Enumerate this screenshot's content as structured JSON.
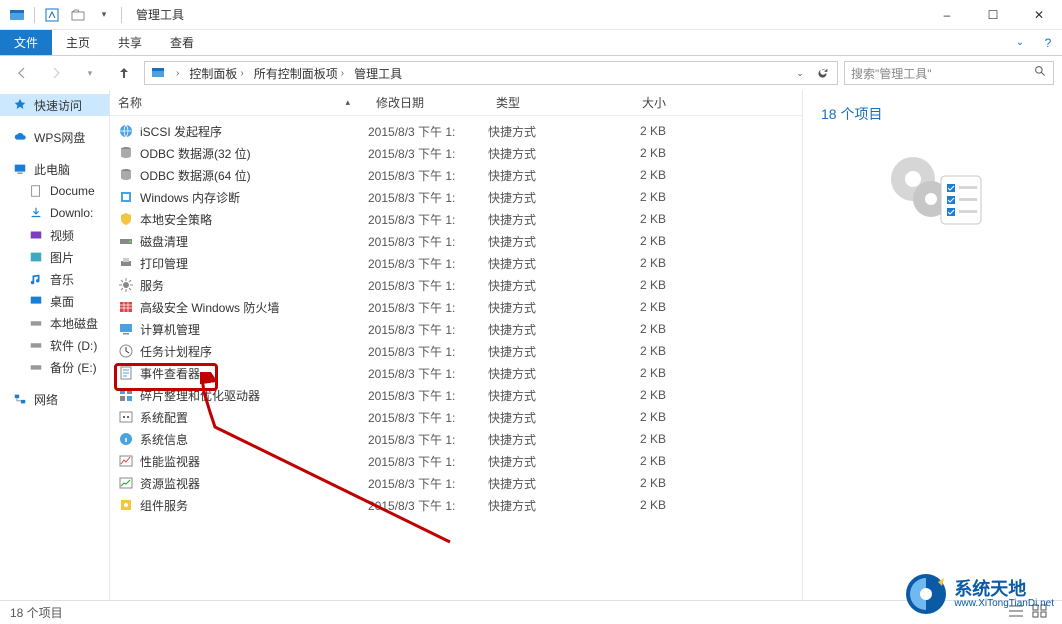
{
  "window": {
    "title": "管理工具",
    "minimize": "–",
    "maximize": "☐",
    "close": "✕"
  },
  "ribbon": {
    "file": "文件",
    "home": "主页",
    "share": "共享",
    "view": "查看"
  },
  "address": {
    "crumbs": [
      "控制面板",
      "所有控制面板项",
      "管理工具"
    ]
  },
  "search": {
    "placeholder": "搜索\"管理工具\""
  },
  "nav": {
    "quick_access": "快速访问",
    "wps": "WPS网盘",
    "this_pc": "此电脑",
    "documents": "Docume",
    "downloads": "Downlo:",
    "video": "视频",
    "pictures": "图片",
    "music": "音乐",
    "desktop": "桌面",
    "localdisk": "本地磁盘",
    "software": "软件 (D:)",
    "backup": "备份 (E:)",
    "network": "网络"
  },
  "columns": {
    "name": "名称",
    "date": "修改日期",
    "type": "类型",
    "size": "大小"
  },
  "files": [
    {
      "name": "iSCSI 发起程序",
      "date": "2015/8/3 下午 1:",
      "type": "快捷方式",
      "size": "2 KB",
      "icon": "globe"
    },
    {
      "name": "ODBC 数据源(32 位)",
      "date": "2015/8/3 下午 1:",
      "type": "快捷方式",
      "size": "2 KB",
      "icon": "db"
    },
    {
      "name": "ODBC 数据源(64 位)",
      "date": "2015/8/3 下午 1:",
      "type": "快捷方式",
      "size": "2 KB",
      "icon": "db"
    },
    {
      "name": "Windows 内存诊断",
      "date": "2015/8/3 下午 1:",
      "type": "快捷方式",
      "size": "2 KB",
      "icon": "chip"
    },
    {
      "name": "本地安全策略",
      "date": "2015/8/3 下午 1:",
      "type": "快捷方式",
      "size": "2 KB",
      "icon": "shield"
    },
    {
      "name": "磁盘清理",
      "date": "2015/8/3 下午 1:",
      "type": "快捷方式",
      "size": "2 KB",
      "icon": "disk"
    },
    {
      "name": "打印管理",
      "date": "2015/8/3 下午 1:",
      "type": "快捷方式",
      "size": "2 KB",
      "icon": "printer"
    },
    {
      "name": "服务",
      "date": "2015/8/3 下午 1:",
      "type": "快捷方式",
      "size": "2 KB",
      "icon": "gear"
    },
    {
      "name": "高级安全 Windows 防火墙",
      "date": "2015/8/3 下午 1:",
      "type": "快捷方式",
      "size": "2 KB",
      "icon": "firewall"
    },
    {
      "name": "计算机管理",
      "date": "2015/8/3 下午 1:",
      "type": "快捷方式",
      "size": "2 KB",
      "icon": "pc"
    },
    {
      "name": "任务计划程序",
      "date": "2015/8/3 下午 1:",
      "type": "快捷方式",
      "size": "2 KB",
      "icon": "clock"
    },
    {
      "name": "事件查看器",
      "date": "2015/8/3 下午 1:",
      "type": "快捷方式",
      "size": "2 KB",
      "icon": "event",
      "highlight": true
    },
    {
      "name": "碎片整理和优化驱动器",
      "date": "2015/8/3 下午 1:",
      "type": "快捷方式",
      "size": "2 KB",
      "icon": "defrag"
    },
    {
      "name": "系统配置",
      "date": "2015/8/3 下午 1:",
      "type": "快捷方式",
      "size": "2 KB",
      "icon": "config"
    },
    {
      "name": "系统信息",
      "date": "2015/8/3 下午 1:",
      "type": "快捷方式",
      "size": "2 KB",
      "icon": "info"
    },
    {
      "name": "性能监视器",
      "date": "2015/8/3 下午 1:",
      "type": "快捷方式",
      "size": "2 KB",
      "icon": "perf"
    },
    {
      "name": "资源监视器",
      "date": "2015/8/3 下午 1:",
      "type": "快捷方式",
      "size": "2 KB",
      "icon": "res"
    },
    {
      "name": "组件服务",
      "date": "2015/8/3 下午 1:",
      "type": "快捷方式",
      "size": "2 KB",
      "icon": "comp"
    }
  ],
  "preview": {
    "count_label": "18 个项目"
  },
  "status": {
    "text": "18 个项目"
  },
  "watermark": {
    "title": "系统天地",
    "url": "www.XiTongTianDi.net"
  }
}
